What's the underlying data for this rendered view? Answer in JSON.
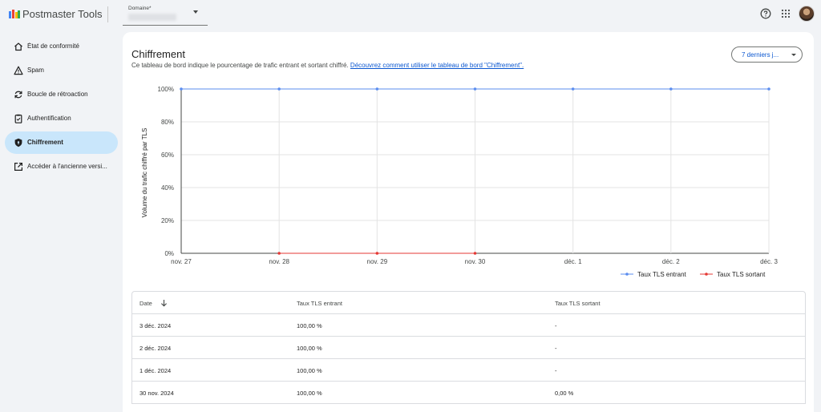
{
  "app": {
    "title": "Postmaster Tools"
  },
  "domain_select": {
    "label": "Domaine*"
  },
  "sidebar": {
    "items": [
      {
        "label": "État de conformité",
        "icon": "home-icon",
        "active": false
      },
      {
        "label": "Spam",
        "icon": "warning-icon",
        "active": false
      },
      {
        "label": "Boucle de rétroaction",
        "icon": "sync-icon",
        "active": false
      },
      {
        "label": "Authentification",
        "icon": "clipboard-check-icon",
        "active": false
      },
      {
        "label": "Chiffrement",
        "icon": "shield-icon",
        "active": true
      },
      {
        "label": "Accéder à l'ancienne versi...",
        "icon": "open-in-new-icon",
        "active": false
      }
    ]
  },
  "main": {
    "title": "Chiffrement",
    "description": "Ce tableau de bord indique le pourcentage de trafic entrant et sortant chiffré. ",
    "link_text": "Découvrez comment utiliser le tableau de bord \"Chiffrement\".",
    "range_button": "7 derniers j..."
  },
  "chart_data": {
    "type": "line",
    "ylabel": "Volume du trafic chiffré par TLS",
    "categories": [
      "nov. 27",
      "nov. 28",
      "nov. 29",
      "nov. 30",
      "déc. 1",
      "déc. 2",
      "déc. 3"
    ],
    "y_ticks": [
      "0%",
      "20%",
      "40%",
      "60%",
      "80%",
      "100%"
    ],
    "ylim": [
      0,
      100
    ],
    "grid": true,
    "legend_position": "bottom-right",
    "series": [
      {
        "name": "Taux TLS entrant",
        "color": "#5b8def",
        "values": [
          100,
          100,
          100,
          100,
          100,
          100,
          100
        ]
      },
      {
        "name": "Taux TLS sortant",
        "color": "#e53935",
        "values": [
          null,
          0,
          0,
          0,
          null,
          null,
          null
        ]
      }
    ]
  },
  "table": {
    "headers": [
      "Date",
      "Taux TLS entrant",
      "Taux TLS sortant"
    ],
    "rows": [
      [
        "3 déc. 2024",
        "100,00 %",
        "-"
      ],
      [
        "2 déc. 2024",
        "100,00 %",
        "-"
      ],
      [
        "1 déc. 2024",
        "100,00 %",
        "-"
      ],
      [
        "30 nov. 2024",
        "100,00 %",
        "0,00 %"
      ]
    ]
  }
}
